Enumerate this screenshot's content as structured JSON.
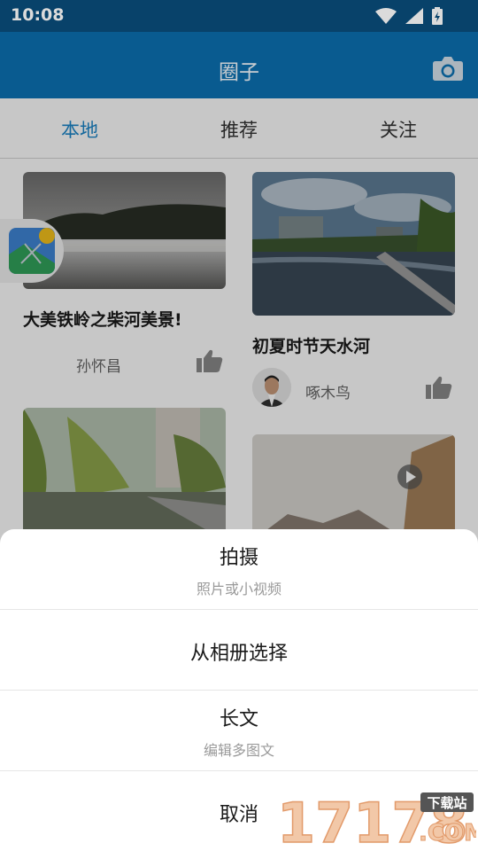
{
  "status": {
    "time": "10:08"
  },
  "appbar": {
    "title": "圈子",
    "camera_icon": "camera-icon"
  },
  "tabs": [
    {
      "label": "本地",
      "active": true
    },
    {
      "label": "推荐",
      "active": false
    },
    {
      "label": "关注",
      "active": false
    }
  ],
  "feed": {
    "cards": [
      {
        "title": "大美铁岭之柴河美景!",
        "author": "孙怀昌"
      },
      {
        "title": "初夏时节天水河",
        "author": "啄木鸟"
      }
    ]
  },
  "sheet": {
    "items": [
      {
        "label": "拍摄",
        "sub": "照片或小视频"
      },
      {
        "label": "从相册选择"
      },
      {
        "label": "长文",
        "sub": "编辑多图文"
      },
      {
        "label": "取消"
      }
    ]
  },
  "watermark": {
    "number": "17178",
    "tag": "下载站",
    "domain": ".COM"
  },
  "colors": {
    "accent": "#1b86c9",
    "appbar": "#0b6aa8",
    "statusbar": "#0a4d7c"
  }
}
